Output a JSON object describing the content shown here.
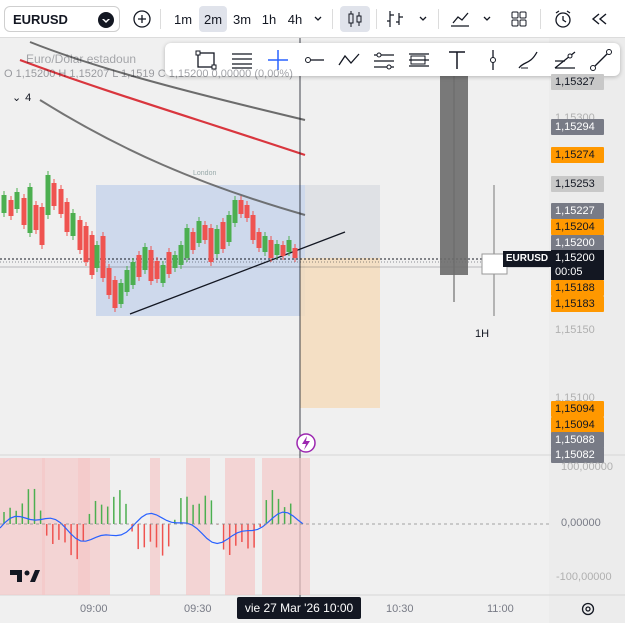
{
  "symbol": "EURUSD",
  "timeframes": [
    "1m",
    "2m",
    "3m",
    "1h",
    "4h"
  ],
  "active_timeframe": "2m",
  "legend": {
    "title": "Euro/Dólar estadoun",
    "ohlc": "O 1,15200 H 1,15207 L 1,1519 C 1,15200 0,00000 (0,00%)",
    "collapse_count": "4"
  },
  "price_labels": [
    {
      "text": "1,15327",
      "kind": "gray"
    },
    {
      "text": "1,15300",
      "kind": "faint"
    },
    {
      "text": "1,15294",
      "kind": "dark"
    },
    {
      "text": "1,15274",
      "kind": "orange"
    },
    {
      "text": "1,15253",
      "kind": "gray"
    },
    {
      "text": "1,15227",
      "kind": "dark"
    },
    {
      "text": "1,15204",
      "kind": "orange"
    },
    {
      "text": "1,15200",
      "kind": "dark"
    },
    {
      "text": "1,15188",
      "kind": "orange"
    },
    {
      "text": "1,15183",
      "kind": "orange"
    },
    {
      "text": "1,15150",
      "kind": "faint"
    },
    {
      "text": "1,15100",
      "kind": "faint"
    },
    {
      "text": "1,15094",
      "kind": "orange"
    },
    {
      "text": "1,15094",
      "kind": "orange"
    },
    {
      "text": "1,15088",
      "kind": "dark"
    },
    {
      "text": "1,15082",
      "kind": "dark"
    }
  ],
  "current_price": {
    "price": "1,15200",
    "countdown": "00:05",
    "tag": "EURUSD"
  },
  "higher_tf_label": "1H",
  "zone_label": "London",
  "oscillator_labels": [
    "100,00000",
    "0,00000",
    "-100,00000"
  ],
  "time_axis": [
    "09:00",
    "09:30",
    "10:30",
    "11:00"
  ],
  "time_cursor": "vie 27 Mar '26   10:00",
  "colors": {
    "up": "#4caf50",
    "down": "#ef5350",
    "accent": "#2962ff",
    "orange": "#ff9800"
  }
}
